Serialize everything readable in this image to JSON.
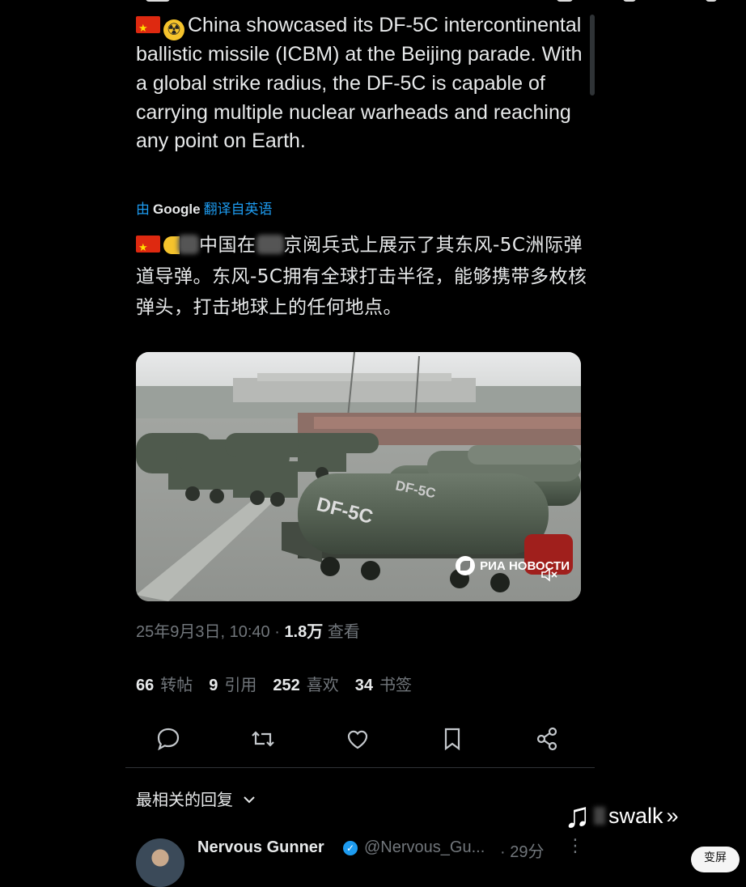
{
  "tweet": {
    "text_en": "China showcased its DF-5C intercontinental ballistic missile (ICBM) at the Beijing parade. With a global strike radius, the DF-5C is capable of carrying multiple nuclear warheads and reaching any point on Earth.",
    "translate_prefix": "由",
    "translate_brand": "Google",
    "translate_suffix": "翻译自英语",
    "text_zh_part1": "中国在",
    "text_zh_part2": "京阅兵式上展示了其东风-5C洲际弹道导弹。东风-5C拥有全球打击半径，能够携带多枚核弹头，打击地球上的任何地点。",
    "media_watermark": "РИА НОВОСТИ",
    "media_label": "DF-5C",
    "date": "25年9月3日, 10:40",
    "views_count": "1.8万",
    "views_label": "查看"
  },
  "stats": [
    {
      "count": "66",
      "label": "转帖"
    },
    {
      "count": "9",
      "label": "引用"
    },
    {
      "count": "252",
      "label": "喜欢"
    },
    {
      "count": "34",
      "label": "书签"
    }
  ],
  "actions": [
    "reply-icon",
    "repost-icon",
    "like-icon",
    "bookmark-icon",
    "share-icon"
  ],
  "replies_header": "最相关的回复",
  "reply": {
    "name": "Nervous Gunner",
    "handle": "@Nervous_Gu...",
    "time": "· 29分"
  },
  "overlay_text": "swalk",
  "corner_button": "变屏",
  "colors": {
    "background": "#000000",
    "text": "#e7e9ea",
    "muted": "#71767b",
    "accent": "#1d9bf0"
  }
}
